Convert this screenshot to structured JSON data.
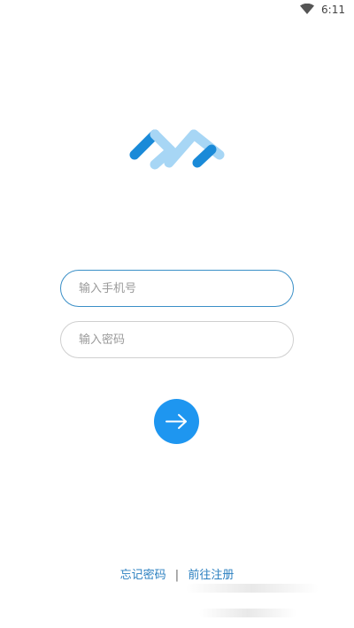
{
  "status_bar": {
    "time": "6:11",
    "wifi_icon": "wifi-icon"
  },
  "logo": {
    "icon": "brand-logo-icon",
    "colors": {
      "dark": "#1a8ad8",
      "light": "#a7d6f5"
    }
  },
  "form": {
    "phone": {
      "placeholder": "输入手机号",
      "value": ""
    },
    "password": {
      "placeholder": "输入密码",
      "value": ""
    },
    "submit": {
      "icon": "arrow-right-icon",
      "color": "#1e96f0"
    }
  },
  "footer": {
    "forgot_password": "忘记密码",
    "separator": "|",
    "register": "前往注册"
  }
}
